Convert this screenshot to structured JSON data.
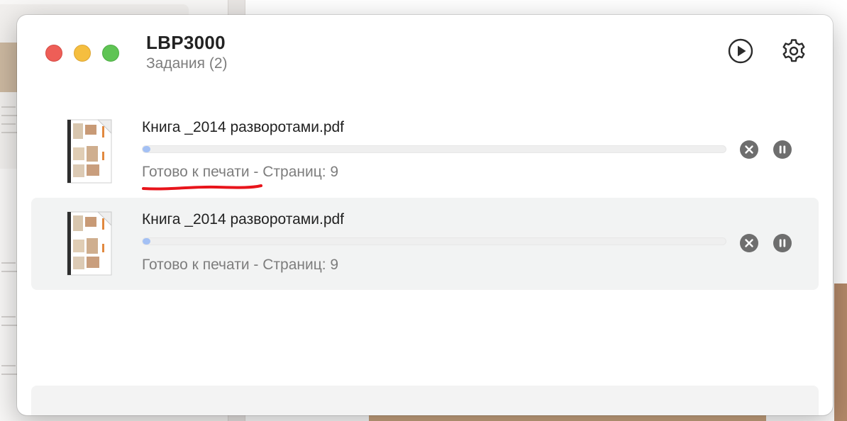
{
  "window": {
    "title": "LBP3000",
    "subtitle": "Задания (2)"
  },
  "header_buttons": {
    "play_icon": "play-circle-icon",
    "settings_icon": "gear-icon"
  },
  "jobs": [
    {
      "name": "Книга _2014 разворотами.pdf",
      "status": "Готово к печати",
      "separator": " - ",
      "pages": "Страниц: 9",
      "progress": 0.0,
      "annotated": true,
      "selected": false
    },
    {
      "name": "Книга _2014 разворотами.pdf",
      "status": "Готово к печати",
      "separator": " - ",
      "pages": "Страниц: 9",
      "progress": 0.0,
      "annotated": false,
      "selected": true
    }
  ],
  "colors": {
    "close": "#ee5e57",
    "minimize": "#f5be3f",
    "zoom": "#5fc454",
    "progress_fill": "#a3c0f4",
    "annotation": "#e8141b"
  }
}
